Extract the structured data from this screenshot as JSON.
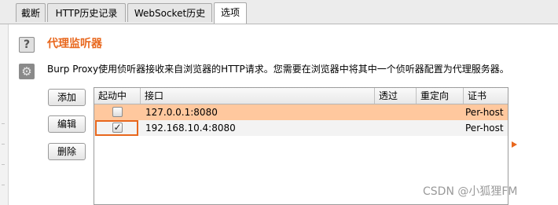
{
  "tabs": [
    {
      "label": "截断",
      "active": false
    },
    {
      "label": "HTTP历史记录",
      "active": false
    },
    {
      "label": "WebSocket历史",
      "active": false
    },
    {
      "label": "选项",
      "active": true
    }
  ],
  "section": {
    "title": "代理监听器",
    "description": "Burp Proxy使用侦听器接收来自浏览器的HTTP请求。您需要在浏览器中将其中一个侦听器配置为代理服务器。"
  },
  "buttons": {
    "add": "添加",
    "edit": "编辑",
    "remove": "删除"
  },
  "table": {
    "columns": [
      "起动中",
      "接口",
      "透过",
      "重定向",
      "证书"
    ],
    "rows": [
      {
        "running": false,
        "interface": "127.0.0.1:8080",
        "invisible": "",
        "redirect": "",
        "certificate": "Per-host",
        "selected": true
      },
      {
        "running": true,
        "interface": "192.168.10.4:8080",
        "invisible": "",
        "redirect": "",
        "certificate": "Per-host",
        "selected": false
      }
    ]
  },
  "colors": {
    "accent": "#e8671d",
    "selected_row": "#ffc89e"
  },
  "watermark": "CSDN @小狐狸FM"
}
